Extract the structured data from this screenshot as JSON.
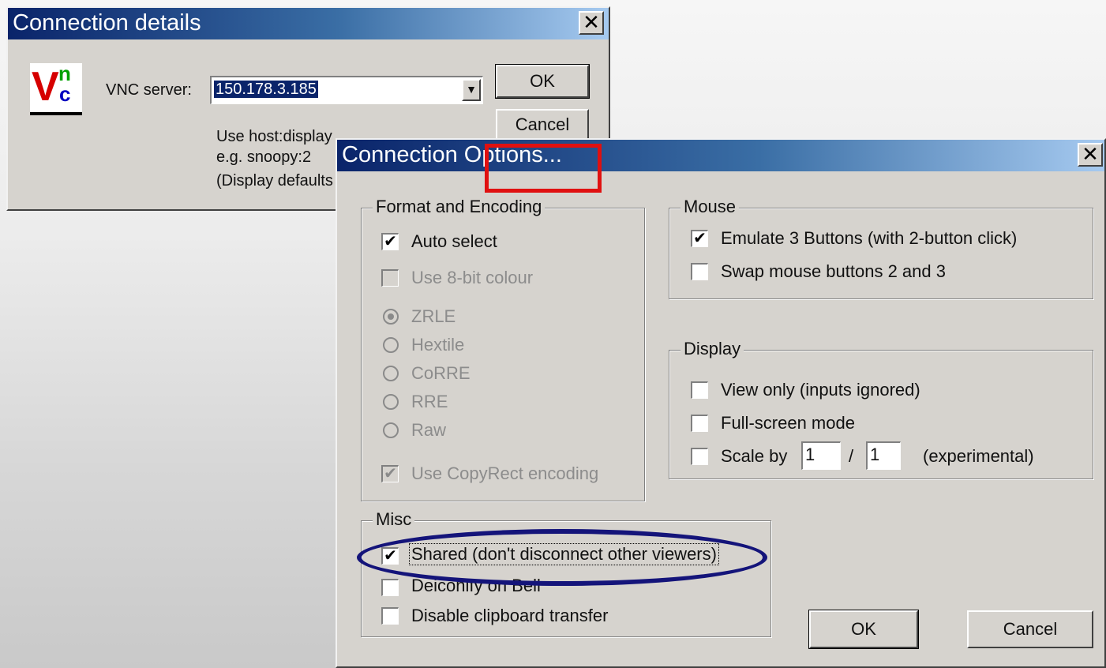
{
  "conn_details": {
    "title": "Connection details",
    "logo": {
      "v": "V",
      "n": "n",
      "c": "c"
    },
    "server_label": "VNC server:",
    "server_value": "150.178.3.185",
    "ok": "OK",
    "cancel": "Cancel",
    "hint1": "Use host:display",
    "hint2": "e.g. snoopy:2",
    "hint3": "(Display defaults"
  },
  "options": {
    "title": "Connection Options...",
    "format": {
      "title": "Format and Encoding",
      "auto_select": "Auto select",
      "use_8bit": "Use 8-bit colour",
      "encodings": [
        "ZRLE",
        "Hextile",
        "CoRRE",
        "RRE",
        "Raw"
      ],
      "copyrect": "Use CopyRect encoding"
    },
    "mouse": {
      "title": "Mouse",
      "emulate": "Emulate 3 Buttons (with 2-button click)",
      "swap": "Swap mouse buttons 2 and 3"
    },
    "display": {
      "title": "Display",
      "view_only": "View only (inputs ignored)",
      "full_screen": "Full-screen mode",
      "scale_by": "Scale by",
      "scale_num": "1",
      "slash": "/",
      "scale_den": "1",
      "experimental": "(experimental)"
    },
    "misc": {
      "title": "Misc",
      "shared": "Shared (don't disconnect other viewers)",
      "deiconify": "Deiconify on Bell",
      "disable_clipboard": "Disable clipboard transfer"
    },
    "ok": "OK",
    "cancel": "Cancel"
  },
  "colors": {
    "highlight_box": "#e01010",
    "highlight_ellipse": "#14147a"
  },
  "icons": [
    "close-icon",
    "dropdown-arrow-icon",
    "check-icon",
    "vnc-logo"
  ]
}
